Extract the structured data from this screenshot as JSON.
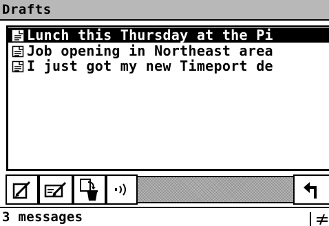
{
  "window": {
    "title": "Drafts"
  },
  "messages": [
    {
      "subject": "Lunch this Thursday at the Pi",
      "selected": true,
      "icon": "document-icon"
    },
    {
      "subject": "Job opening in Northeast area",
      "selected": false,
      "icon": "document-icon"
    },
    {
      "subject": "I just got my new Timeport de",
      "selected": false,
      "icon": "document-icon"
    }
  ],
  "toolbar": {
    "buttons": [
      {
        "name": "compose-button",
        "icon": "compose-icon"
      },
      {
        "name": "reply-button",
        "icon": "edit-envelope-icon"
      },
      {
        "name": "delete-button",
        "icon": "trash-icon"
      },
      {
        "name": "speaker-button",
        "icon": "sound-waves-icon"
      },
      {
        "name": "back-button",
        "icon": "back-arrow-icon"
      }
    ]
  },
  "status": {
    "count_text": "3 messages",
    "signal_icon": "signal-icon"
  }
}
